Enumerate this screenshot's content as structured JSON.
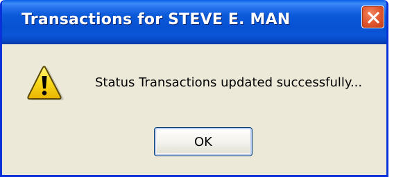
{
  "window": {
    "title": "Transactions for STEVE E. MAN"
  },
  "dialog": {
    "icon": "warning-icon",
    "message": "Status Transactions updated successfully...",
    "ok_label": "OK"
  },
  "colors": {
    "titlebar": "#0752d3",
    "frame": "#0831d9",
    "client_background": "#ece9d8",
    "close_button": "#e25b33",
    "warning_yellow": "#f9d91c"
  }
}
